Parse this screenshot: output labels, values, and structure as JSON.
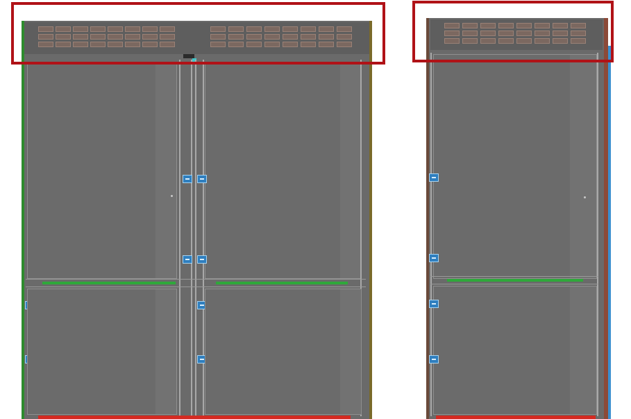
{
  "colors": {
    "cabinet": "#6a6a6a",
    "vent": "#7b6860",
    "hinge": "#2f7fbf",
    "divider": "#2fa83a",
    "base": "#d42a22",
    "highlight": "#b01217",
    "frame_left": "#2e8b2e",
    "frame_right_double": "#7a6a2a",
    "frame_right_single": "#8b4a38",
    "frame_edge_single": "#3a8fd0"
  },
  "units": {
    "double": {
      "door_labels": [
        "",
        ""
      ]
    },
    "single": {
      "door_labels": [
        ""
      ]
    }
  },
  "annotations": [
    "highlight",
    "highlight"
  ]
}
